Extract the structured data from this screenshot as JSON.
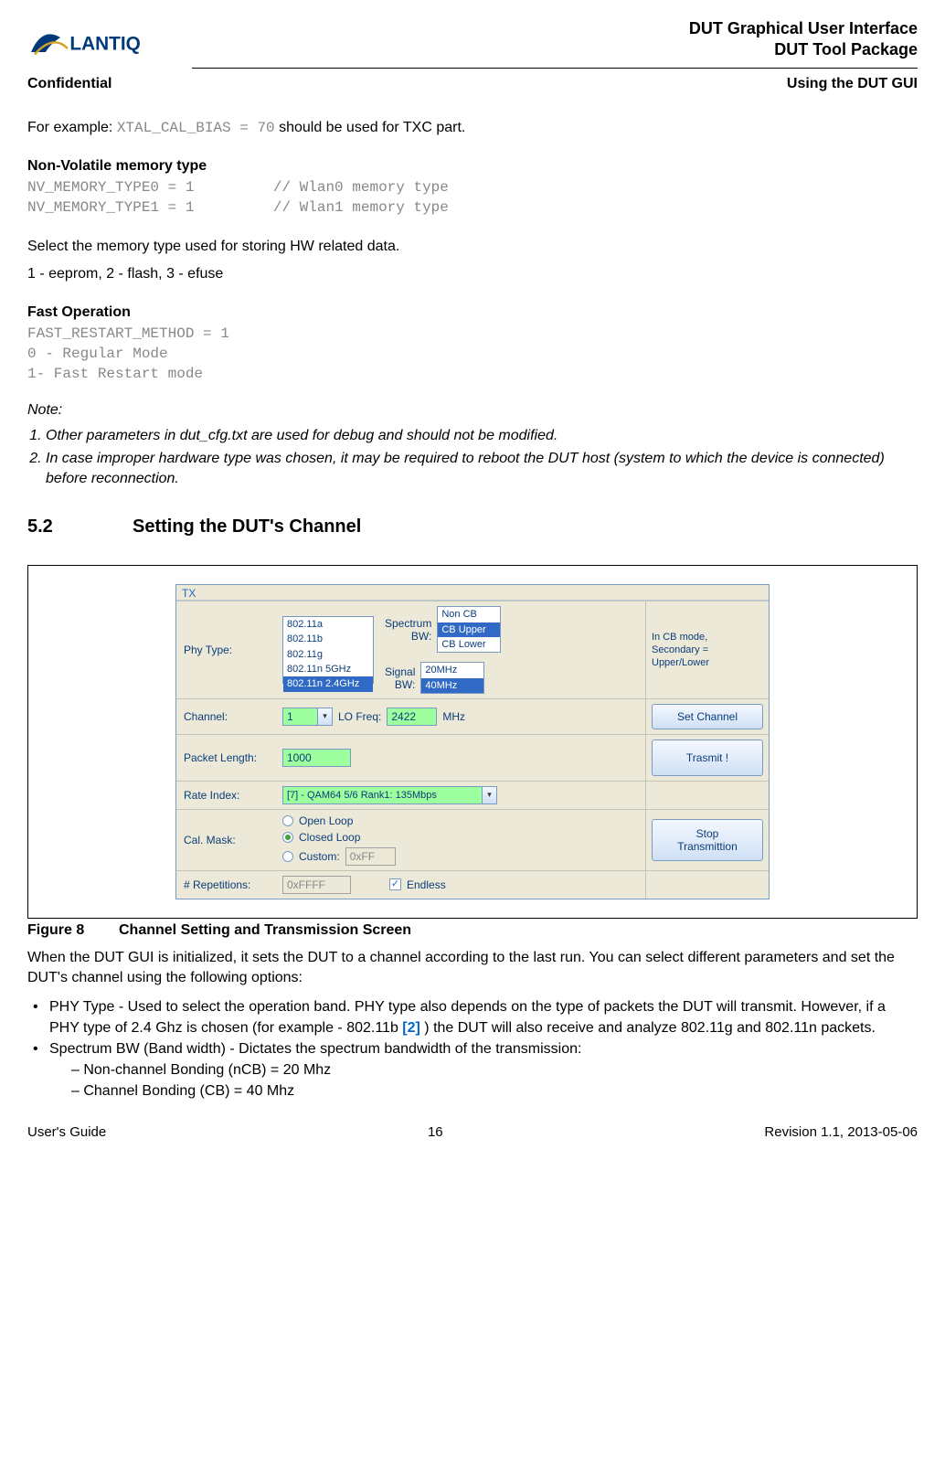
{
  "header": {
    "title1": "DUT Graphical User Interface",
    "title2": "DUT Tool Package",
    "confidential": "Confidential",
    "section": "Using the DUT GUI"
  },
  "example_line_prefix": "For example: ",
  "example_code": "XTAL_CAL_BIAS = 70",
  "example_line_suffix": " should be used for TXC part.",
  "nv": {
    "heading": "Non-Volatile memory type",
    "code": "NV_MEMORY_TYPE0 = 1         // Wlan0 memory type\nNV_MEMORY_TYPE1 = 1         // Wlan1 memory type",
    "desc1": "Select the memory type used for storing HW related data.",
    "desc2": "1 - eeprom, 2 - flash, 3 - efuse"
  },
  "fast": {
    "heading": "Fast Operation",
    "code": "FAST_RESTART_METHOD = 1\n0 - Regular Mode\n1- Fast Restart mode"
  },
  "note_label": "Note:",
  "notes": [
    "Other parameters in dut_cfg.txt are used for debug and should not be modified.",
    "In case improper hardware type was chosen, it may be required to reboot the DUT host (system to which the device is connected) before reconnection."
  ],
  "section52": {
    "num": "5.2",
    "title": "Setting the DUT's Channel"
  },
  "gui": {
    "tx": "TX",
    "phy_label": "Phy Type:",
    "phy_options": [
      "802.11a",
      "802.11b",
      "802.11g",
      "802.11n 5GHz",
      "802.11n 2.4GHz"
    ],
    "phy_selected_index": 4,
    "spectrum_label": "Spectrum\nBW:",
    "spectrum_options": [
      "Non CB",
      "CB Upper",
      "CB Lower"
    ],
    "spectrum_selected_index": 1,
    "signal_label": "Signal\nBW:",
    "signal_options": [
      "20MHz",
      "40MHz"
    ],
    "signal_selected_index": 1,
    "cb_note": "In CB mode,\nSecondary =\nUpper/Lower",
    "channel_label": "Channel:",
    "channel_value": "1",
    "lo_label": "LO Freq:",
    "lo_value": "2422",
    "mhz": "MHz",
    "set_channel": "Set Channel",
    "packet_label": "Packet Length:",
    "packet_value": "1000",
    "transmit": "Trasmit !",
    "rate_label": "Rate Index:",
    "rate_value": "[7] - QAM64 5/6 Rank1: 135Mbps",
    "cal_label": "Cal. Mask:",
    "open_loop": "Open Loop",
    "closed_loop": "Closed Loop",
    "custom": "Custom:",
    "custom_value": "0xFF",
    "stop": "Stop\nTransmittion",
    "reps_label": "# Repetitions:",
    "reps_value": "0xFFFF",
    "endless": "Endless"
  },
  "figure": {
    "num": "Figure 8",
    "caption": "Channel Setting and Transmission Screen"
  },
  "after_fig": "When the DUT GUI is initialized, it sets the DUT to a channel according to the last run. You can select different parameters and set the DUT's channel using the following options:",
  "bullets": {
    "b1_pre": "PHY Type - Used to select the operation band. PHY type also depends on the type of packets the DUT will transmit. However, if a PHY type of 2.4 Ghz is chosen (for example - 802.11b ",
    "b1_ref": "[2]",
    "b1_post": " ) the DUT will also receive and analyze 802.11g and 802.11n packets.",
    "b2": "Spectrum BW (Band width) - Dictates the spectrum bandwidth of the transmission:",
    "b2a": "Non-channel Bonding (nCB) = 20 Mhz",
    "b2b": "Channel Bonding (CB) = 40 Mhz"
  },
  "footer": {
    "left": "User's Guide",
    "center": "16",
    "right": "Revision 1.1, 2013-05-06"
  }
}
